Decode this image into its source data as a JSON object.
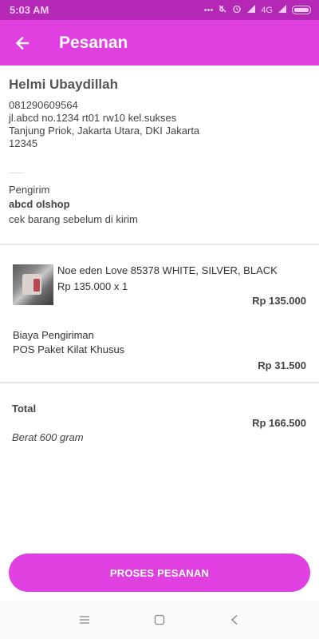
{
  "status_bar": {
    "time": "5:03 AM",
    "network": "4G"
  },
  "app_bar": {
    "title": "Pesanan",
    "back_icon": "arrow-left-icon",
    "background_color": "#e040e0"
  },
  "address": {
    "name": "Helmi Ubaydillah",
    "phone": "081290609564",
    "street": "jl.abcd no.1234 rt01 rw10 kel.sukses",
    "city": "Tanjung Priok, Jakarta Utara, DKI Jakarta",
    "postal_code": "12345"
  },
  "sender": {
    "label": "Pengirim",
    "name": "abcd olshop",
    "note": "cek barang sebelum di kirim"
  },
  "product": {
    "name": "Noe eden Love 85378 WHITE, SILVER, BLACK",
    "price_qty": "Rp 135.000 x 1",
    "subtotal": "Rp 135.000"
  },
  "shipping": {
    "label": "Biaya Pengiriman",
    "method": "POS Paket Kilat Khusus",
    "cost": "Rp 31.500"
  },
  "total": {
    "label": "Total",
    "value": "Rp 166.500",
    "weight": "Berat 600 gram"
  },
  "actions": {
    "process_label": "PROSES PESANAN"
  },
  "nav": {
    "menu_icon": "menu-icon",
    "home_icon": "home-square-icon",
    "back_icon": "back-triangle-icon"
  }
}
